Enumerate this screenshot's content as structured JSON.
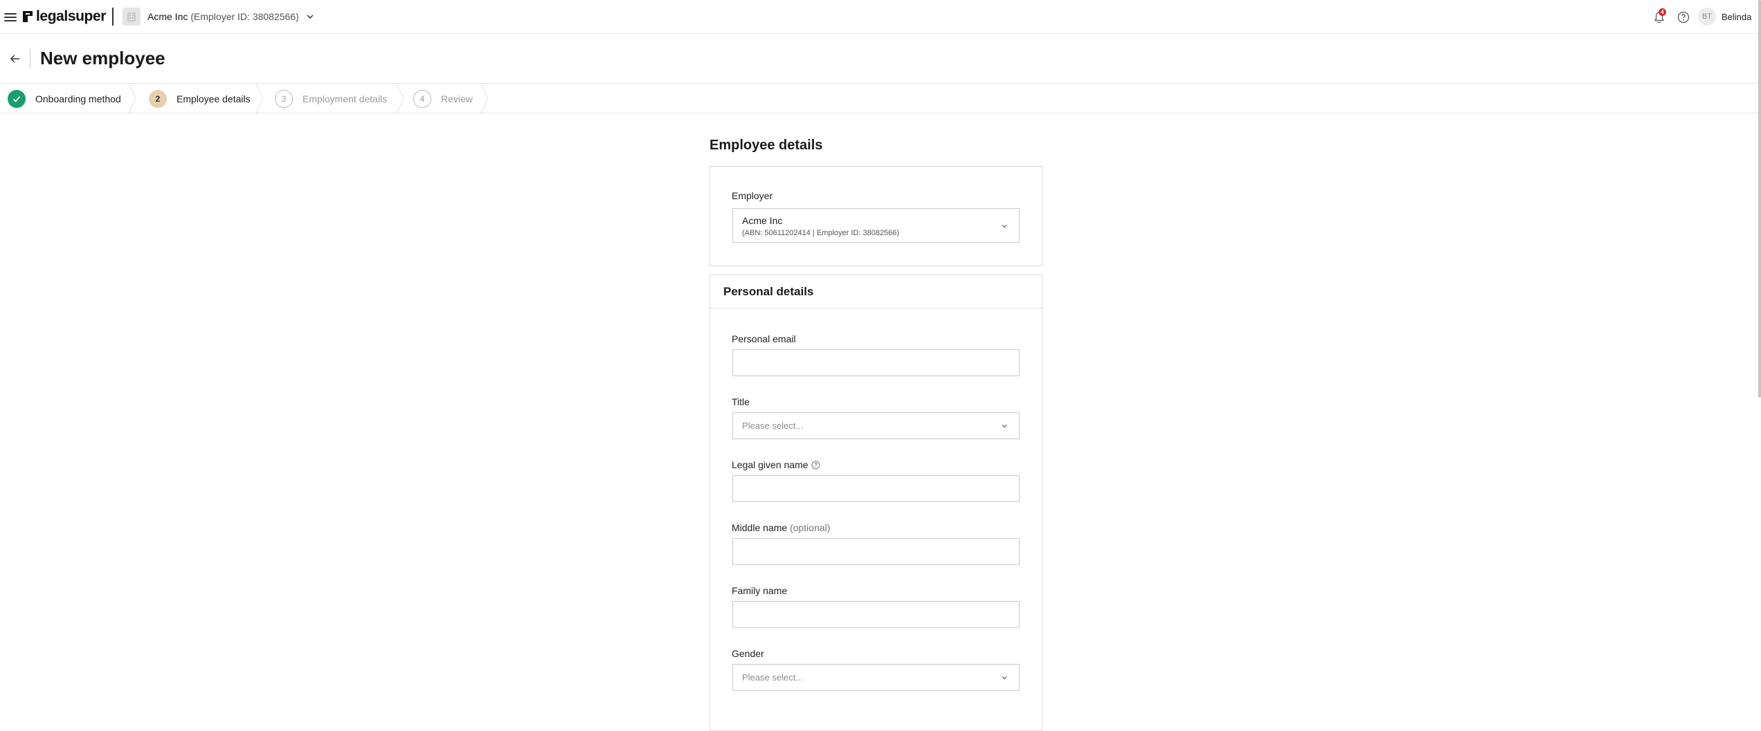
{
  "topbar": {
    "logo_text": "legalsuper",
    "employer_name": "Acme Inc",
    "employer_id_text": "(Employer ID: 38082566)",
    "notification_count": "4",
    "avatar_initials": "BT",
    "user_name": "Belinda"
  },
  "page": {
    "title": "New employee"
  },
  "stepper": {
    "steps": [
      {
        "number": "",
        "label": "Onboarding method",
        "state": "done"
      },
      {
        "number": "2",
        "label": "Employee details",
        "state": "active"
      },
      {
        "number": "3",
        "label": "Employment details",
        "state": "pending"
      },
      {
        "number": "4",
        "label": "Review",
        "state": "pending"
      }
    ]
  },
  "form": {
    "section_title": "Employee details",
    "employer": {
      "label": "Employer",
      "selected_name": "Acme Inc",
      "selected_detail": "(ABN: 50611202414 | Employer ID: 38082566)"
    },
    "personal": {
      "header": "Personal details",
      "email_label": "Personal email",
      "email_value": "",
      "title_label": "Title",
      "title_placeholder": "Please select...",
      "given_name_label": "Legal given name",
      "given_name_value": "",
      "middle_name_label": "Middle name",
      "middle_name_optional": "(optional)",
      "middle_name_value": "",
      "family_name_label": "Family name",
      "family_name_value": "",
      "gender_label": "Gender",
      "gender_placeholder": "Please select..."
    }
  },
  "colors": {
    "step_done": "#1b9e6e",
    "step_active": "#e8cfae",
    "badge": "#d92a2a"
  }
}
